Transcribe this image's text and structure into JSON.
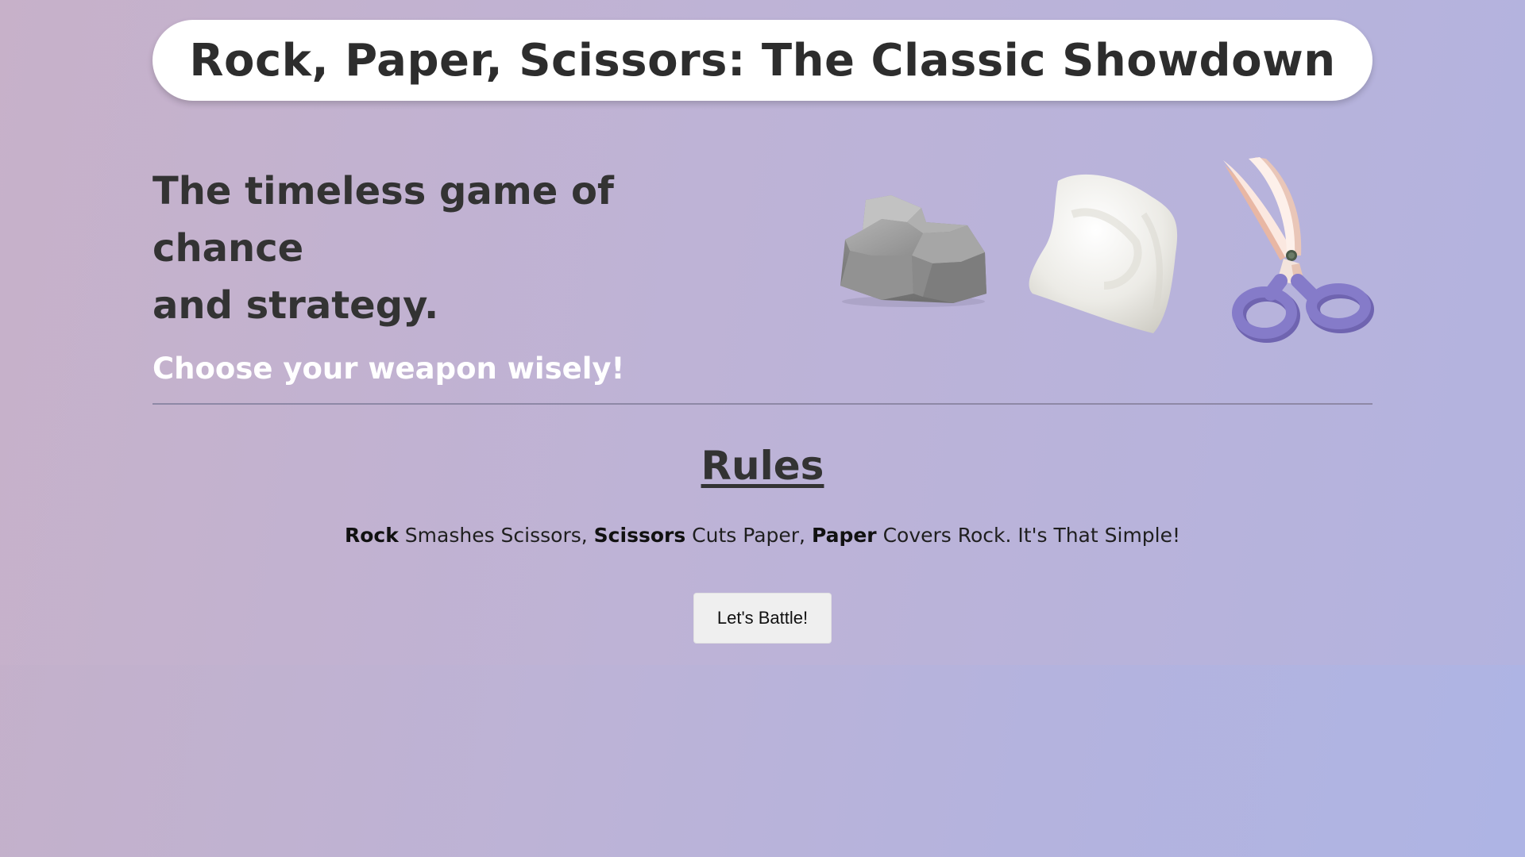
{
  "header": {
    "title": "Rock, Paper, Scissors: The Classic Showdown"
  },
  "hero": {
    "tagline_line1": "The timeless game of chance",
    "tagline_line2": "and strategy.",
    "subtagline": "Choose your weapon wisely!",
    "weapons": [
      {
        "name": "rock",
        "icon": "rock-icon"
      },
      {
        "name": "paper",
        "icon": "paper-icon"
      },
      {
        "name": "scissors",
        "icon": "scissors-icon"
      }
    ]
  },
  "rules": {
    "heading": "Rules",
    "parts": [
      {
        "bold": "Rock",
        "text": " Smashes Scissors, "
      },
      {
        "bold": "Scissors",
        "text": " Cuts Paper, "
      },
      {
        "bold": "Paper",
        "text": " Covers Rock. It's That Simple!"
      }
    ]
  },
  "action": {
    "battle_label": "Let's Battle!"
  },
  "colors": {
    "background_start": "#c5b0c8",
    "background_end": "#aeb4e4",
    "header_bg": "#ffffff",
    "subtagline": "#ffffff",
    "scissors_handle": "#7c72c0",
    "scissors_blade": "#fbe8e0"
  }
}
